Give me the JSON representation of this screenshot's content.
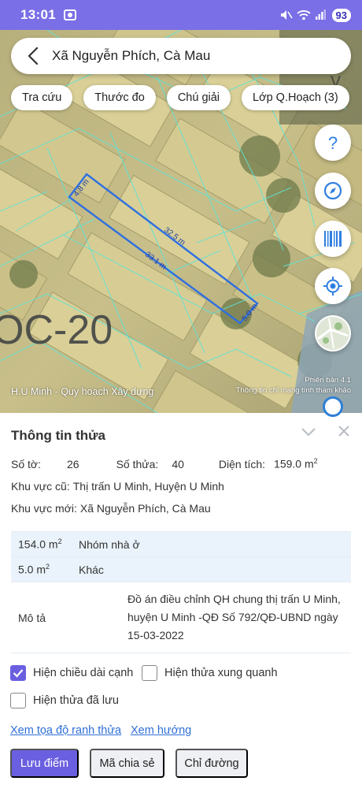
{
  "status_bar": {
    "time": "13:01",
    "battery": "93"
  },
  "search": {
    "text": "Xã Nguyễn Phích, Cà Mau"
  },
  "chips": [
    "Tra cứu",
    "Thước đo",
    "Chú giải",
    "Lớp Q.Hoạch (3)"
  ],
  "map": {
    "zone_label": "OC-20",
    "edge_labels": [
      "4.8 m",
      "32.5 m",
      "33.1 m",
      "5.0 m"
    ],
    "caption_left": "H.U Minh - Quy hoạch Xây dựng",
    "version": "Phiên bản 4.1",
    "caption_right": "Thông tin chỉ mang tính tham khảo",
    "fab_icons": [
      "help-icon",
      "compass-icon",
      "barcode-icon",
      "locate-icon",
      "map-thumbnail-icon"
    ]
  },
  "parcel": {
    "title": "Thông tin thửa",
    "so_to_label": "Số tờ:",
    "so_to": "26",
    "so_thua_label": "Số thửa:",
    "so_thua": "40",
    "dien_tich_label": "Diện tích:",
    "dien_tich": "159.0 m",
    "dien_tich_unit_exp": "2",
    "khu_vuc_cu_label": "Khu vực cũ:",
    "khu_vuc_cu": "Thị trấn U Minh, Huyện U Minh",
    "khu_vuc_moi_label": "Khu vực mới:",
    "khu_vuc_moi": "Xã Nguyễn Phích, Cà Mau",
    "land_use": [
      {
        "area": "154.0 m",
        "exp": "2",
        "type": "Nhóm nhà ở"
      },
      {
        "area": "5.0 m",
        "exp": "2",
        "type": "Khác"
      }
    ],
    "mo_ta_label": "Mô tả",
    "mo_ta": "Đồ án điều chỉnh QH chung thị trấn U Minh, huyện U Minh -QĐ Số 792/QĐ-UBND ngày 15-03-2022"
  },
  "options": {
    "show_edge_length": {
      "label": "Hiện chiều dài cạnh",
      "checked": true
    },
    "show_neighbors": {
      "label": "Hiện thửa xung quanh",
      "checked": false
    },
    "show_saved": {
      "label": "Hiện thửa đã lưu",
      "checked": false
    }
  },
  "links": {
    "coords": "Xem tọa độ ranh thửa",
    "direction": "Xem hướng"
  },
  "buttons": {
    "save_point": "Lưu điểm",
    "share_code": "Mã chia sẻ",
    "directions": "Chỉ đường"
  },
  "colors": {
    "accent": "#6a5fe0",
    "status_bar": "#7a6fe6",
    "parcel_outline": "#2f6fe0",
    "link": "#2e6fd8"
  }
}
